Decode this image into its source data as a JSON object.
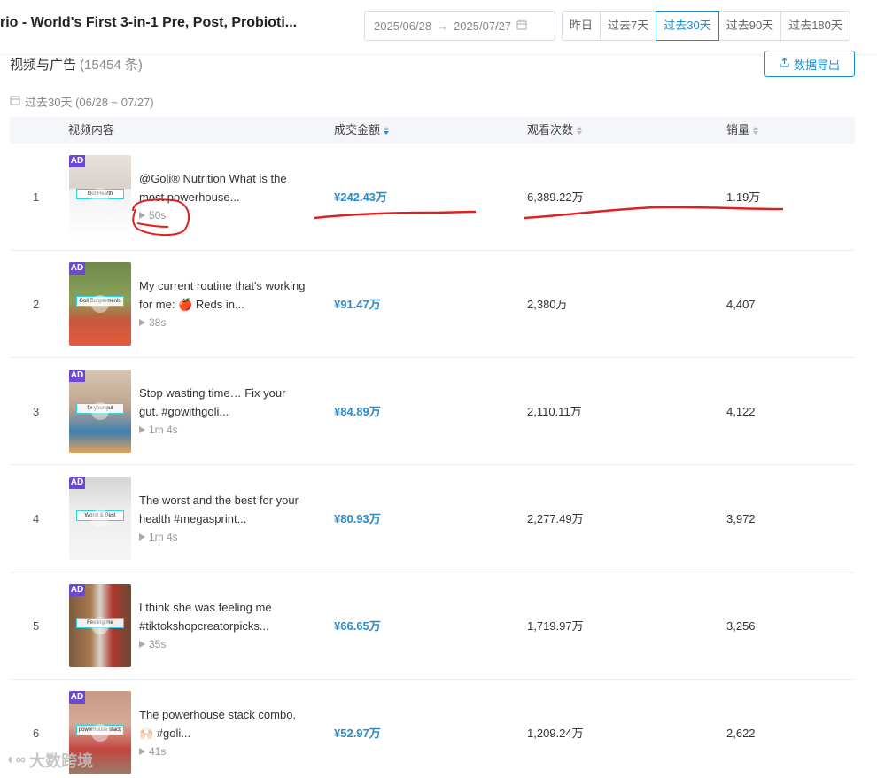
{
  "header": {
    "product_title": "rio - World's First 3-in-1 Pre, Post, Probioti...",
    "date_start": "2025/06/28",
    "date_end": "2025/07/27",
    "range_options": [
      "昨日",
      "过去7天",
      "过去30天",
      "过去90天",
      "过去180天"
    ],
    "active_range": "过去30天"
  },
  "section": {
    "title": "视频与广告",
    "count": "(15454 条)",
    "export_label": "数据导出",
    "period_label": "过去30天 (06/28 ~ 07/27)"
  },
  "table": {
    "columns": {
      "content": "视频内容",
      "amount": "成交金额",
      "views": "观看次数",
      "sales": "销量"
    },
    "rows": [
      {
        "rank": "1",
        "ad_badge": "AD",
        "thumb_text": "Gut Health",
        "title": "@Goli® Nutrition What is the most powerhouse...",
        "duration": "50s",
        "amount": "¥242.43万",
        "views": "6,389.22万",
        "sales": "1.19万"
      },
      {
        "rank": "2",
        "ad_badge": "AD",
        "thumb_text": "Goli Supplements",
        "title": "My current routine that's working for me: 🍎 Reds in...",
        "duration": "38s",
        "amount": "¥91.47万",
        "views": "2,380万",
        "sales": "4,407"
      },
      {
        "rank": "3",
        "ad_badge": "AD",
        "thumb_text": "fix your gut",
        "title": "Stop wasting time… Fix your gut. #gowithgoli...",
        "duration": "1m 4s",
        "amount": "¥84.89万",
        "views": "2,110.11万",
        "sales": "4,122"
      },
      {
        "rank": "4",
        "ad_badge": "AD",
        "thumb_text": "Worst & Best",
        "title": "The worst and the best for your health #megasprint...",
        "duration": "1m 4s",
        "amount": "¥80.93万",
        "views": "2,277.49万",
        "sales": "3,972"
      },
      {
        "rank": "5",
        "ad_badge": "AD",
        "thumb_text": "Feeling me",
        "title": "I think she was feeling me #tiktokshopcreatorpicks...",
        "duration": "35s",
        "amount": "¥66.65万",
        "views": "1,719.97万",
        "sales": "3,256"
      },
      {
        "rank": "6",
        "ad_badge": "AD",
        "thumb_text": "powerhouse stack",
        "title": "The powerhouse stack combo. 🙌🏻 #goli...",
        "duration": "41s",
        "amount": "¥52.97万",
        "views": "1,209.24万",
        "sales": "2,622"
      }
    ]
  },
  "watermark": "大数跨境",
  "colors": {
    "accent": "#1a8fd0",
    "amount": "#2b8ac7",
    "ad_badge": "#6d48d6",
    "annotation": "#e02020"
  }
}
